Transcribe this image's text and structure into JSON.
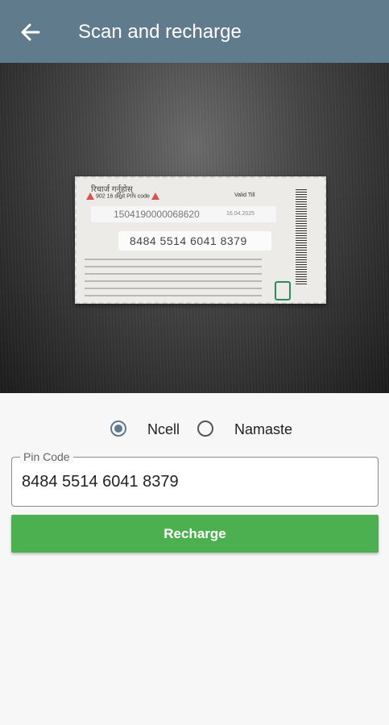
{
  "appbar": {
    "title": "Scan and recharge",
    "back_icon": "arrow-left-icon"
  },
  "scan_preview": {
    "card_header": "रिचार्ज गर्नुहोस्",
    "card_hints": "902  16 digit PIN code",
    "valid_till_label": "Valid Till",
    "serial_number": "1504190000068620",
    "expiry_date": "16.04.2025",
    "pin_number": "8484 5514 6041 8379"
  },
  "operators": {
    "options": [
      {
        "label": "Ncell",
        "selected": true
      },
      {
        "label": "Namaste",
        "selected": false
      }
    ]
  },
  "pin_field": {
    "label": "Pin Code",
    "value": "8484 5514 6041 8379"
  },
  "recharge_button": {
    "label": "Recharge",
    "color": "#4caf50"
  },
  "colors": {
    "appbar": "#5f7b8c",
    "accent": "#5f7b8c"
  }
}
